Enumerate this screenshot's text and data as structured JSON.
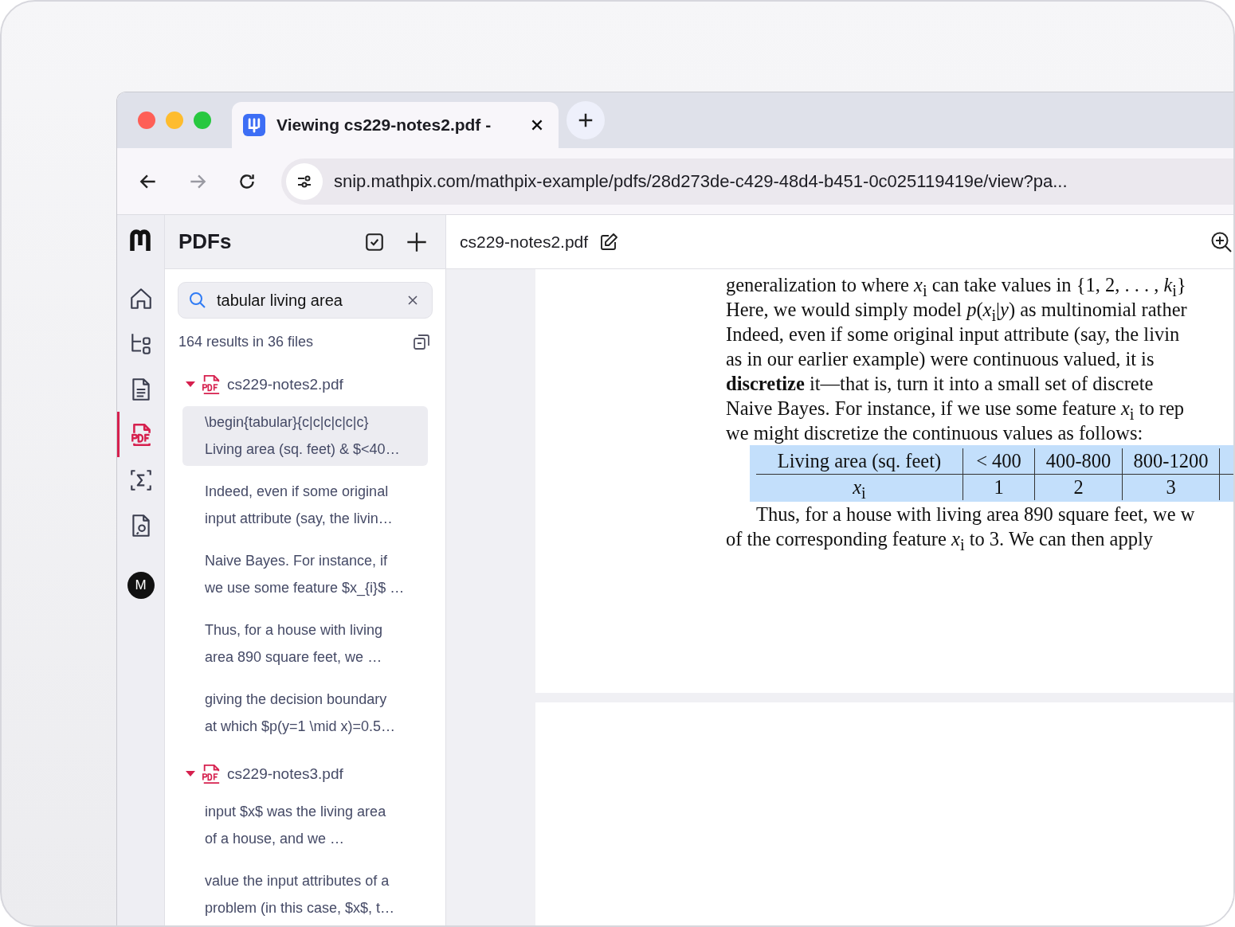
{
  "browser": {
    "tabs": [
      {
        "title": "Viewing cs229-notes2.pdf -",
        "selected": true
      }
    ],
    "nav": [
      {
        "kind": "back",
        "disabled": false
      },
      {
        "kind": "forward",
        "disabled": true
      },
      {
        "kind": "reload",
        "disabled": false
      }
    ],
    "url": "snip.mathpix.com/mathpix-example/pdfs/28d273de-c429-48d4-b451-0c025119419e/view?pa..."
  },
  "rail": {
    "items": [
      {
        "kind": "home",
        "selected": false
      },
      {
        "kind": "tree",
        "selected": false
      },
      {
        "kind": "document",
        "selected": false
      },
      {
        "kind": "pdf",
        "selected": true
      },
      {
        "kind": "sigma",
        "selected": false
      },
      {
        "kind": "file-search",
        "selected": false
      }
    ],
    "avatar": "M"
  },
  "sidebar": {
    "title": "PDFs",
    "search": {
      "value": "tabular living area"
    },
    "count": "164 results in 36 files",
    "files": [
      {
        "name": "cs229-notes2.pdf",
        "expanded": true,
        "results": [
          {
            "lines": [
              "\\begin{tabular}{c|c|c|c|c|c}",
              "Living area (sq. feet) & $<40…"
            ],
            "selected": true
          },
          {
            "lines": [
              "Indeed, even if some original",
              "input attribute (say, the livin…"
            ],
            "selected": false
          },
          {
            "lines": [
              "Naive Bayes. For instance, if",
              "we use some feature $x_{i}$ …"
            ],
            "selected": false
          },
          {
            "lines": [
              "Thus, for a house with living",
              "area 890 square feet, we …"
            ],
            "selected": false
          },
          {
            "lines": [
              "giving the decision boundary",
              "at which $p(y=1 \\mid x)=0.5…"
            ],
            "selected": false
          }
        ]
      },
      {
        "name": "cs229-notes3.pdf",
        "expanded": true,
        "results": [
          {
            "lines": [
              "input $x$ was the living area",
              "of a house, and we …"
            ],
            "selected": false
          },
          {
            "lines": [
              "value the input attributes of a",
              "problem (in this case, $x$, t…"
            ],
            "selected": false
          }
        ]
      }
    ]
  },
  "document": {
    "title": "cs229-notes2.pdf",
    "lines_before": [
      "generalization to where *x*$_{i}$ can take values in {1, 2, . . . , *k*$_{i}$}",
      "Here, we would simply model *p*(*x*$_{i}$|*y*) as multinomial rather",
      "Indeed, even if some original input attribute (say, the livin",
      "as in our earlier example) were continuous valued, it is",
      "**discretize** it—that is, turn it into a small set of discrete",
      "Naive Bayes. For instance, if we use some feature *x*$_{i}$ to rep",
      "we might discretize the continuous values as follows:"
    ],
    "table": {
      "highlighted": true,
      "header": [
        "Living area (sq. feet)",
        "< 400",
        "400-800",
        "800-1200"
      ],
      "row": [
        "*x*$_{i}$",
        "1",
        "2",
        "3"
      ]
    },
    "lines_after": [
      "Thus, for a house with living area 890 square feet, we w",
      "of the corresponding feature *x*$_{i}$ to 3. We can then apply"
    ]
  }
}
